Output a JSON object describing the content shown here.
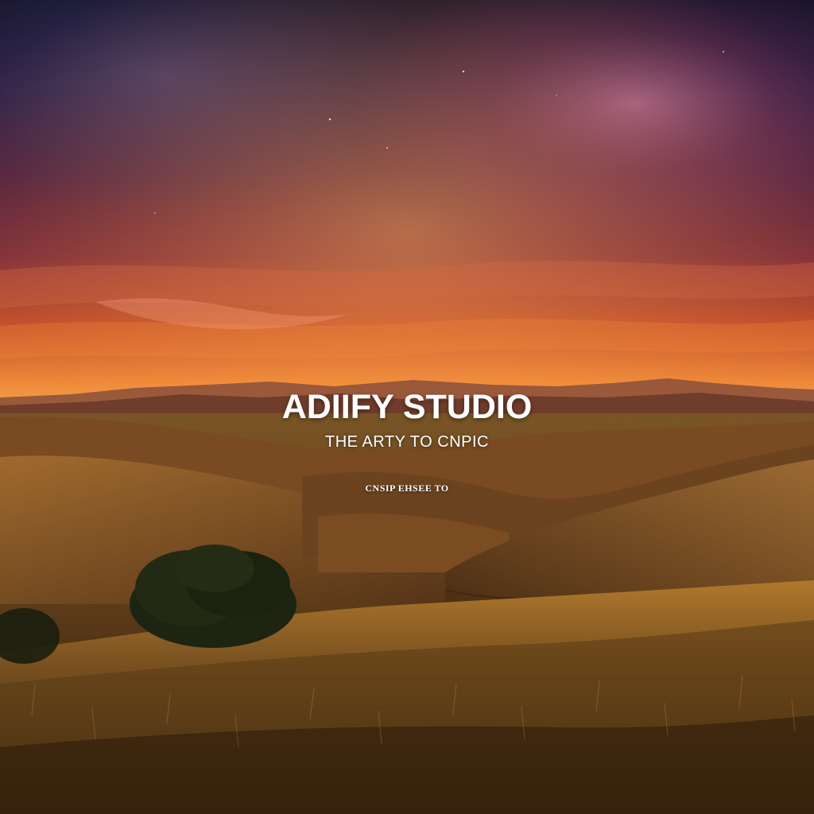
{
  "branding": {
    "title": "ADIIFY STUDIO",
    "tagline": "THE ARTY TO CNPIC",
    "small_text": "CNSIP EHSEE TO"
  },
  "palette": {
    "sky_top": "#1b1630",
    "sky_mid": "#5a2346",
    "sky_horizon": "#e36a2a",
    "hills": "#6a4020",
    "grass": "#8a5a1c"
  }
}
